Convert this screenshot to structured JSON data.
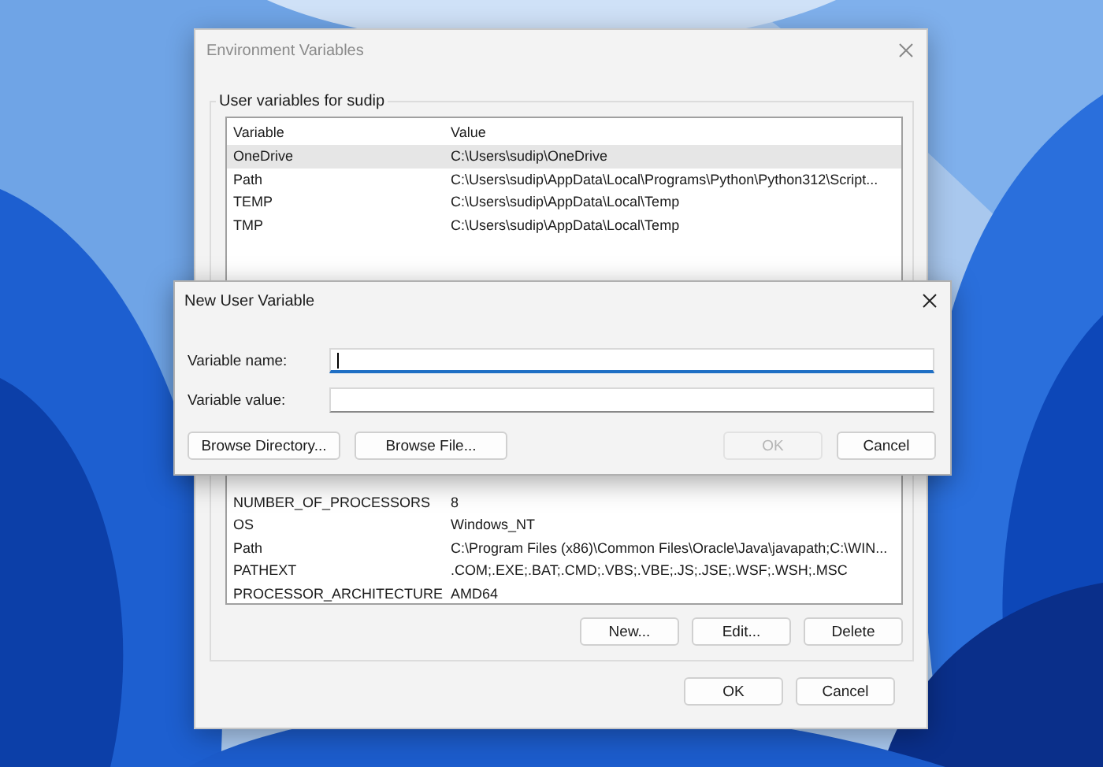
{
  "window": {
    "title": "Environment Variables",
    "user_group": {
      "title": "User variables for sudip",
      "columns": [
        "Variable",
        "Value"
      ],
      "rows": [
        {
          "variable": "OneDrive",
          "value": "C:\\Users\\sudip\\OneDrive",
          "selected": true
        },
        {
          "variable": "Path",
          "value": "C:\\Users\\sudip\\AppData\\Local\\Programs\\Python\\Python312\\Script...",
          "selected": false
        },
        {
          "variable": "TEMP",
          "value": "C:\\Users\\sudip\\AppData\\Local\\Temp",
          "selected": false
        },
        {
          "variable": "TMP",
          "value": "C:\\Users\\sudip\\AppData\\Local\\Temp",
          "selected": false
        }
      ]
    },
    "system_group": {
      "rows": [
        {
          "variable": "NUMBER_OF_PROCESSORS",
          "value": "8",
          "selected": false
        },
        {
          "variable": "OS",
          "value": "Windows_NT",
          "selected": false
        },
        {
          "variable": "Path",
          "value": "C:\\Program Files (x86)\\Common Files\\Oracle\\Java\\javapath;C:\\WIN...",
          "selected": false
        },
        {
          "variable": "PATHEXT",
          "value": ".COM;.EXE;.BAT;.CMD;.VBS;.VBE;.JS;.JSE;.WSF;.WSH;.MSC",
          "selected": false
        },
        {
          "variable": "PROCESSOR_ARCHITECTURE",
          "value": "AMD64",
          "selected": false
        }
      ],
      "buttons": [
        "New...",
        "Edit...",
        "Delete"
      ]
    },
    "buttons": [
      "OK",
      "Cancel"
    ]
  },
  "dialog": {
    "title": "New User Variable",
    "fields": [
      {
        "label": "Variable name:",
        "focused": true
      },
      {
        "label": "Variable value:",
        "focused": false
      }
    ],
    "buttons": [
      {
        "label": "Browse Directory...",
        "disabled": false
      },
      {
        "label": "Browse File...",
        "disabled": false
      },
      {
        "label": "OK",
        "disabled": true
      },
      {
        "label": "Cancel",
        "disabled": false
      }
    ]
  }
}
